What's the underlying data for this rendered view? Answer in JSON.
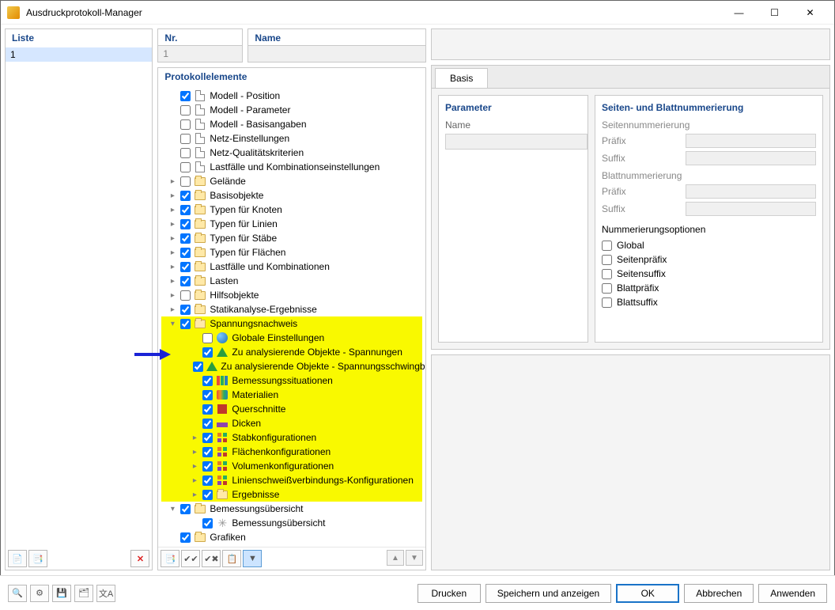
{
  "window": {
    "title": "Ausdruckprotokoll-Manager"
  },
  "liste": {
    "header": "Liste",
    "items": [
      "1"
    ]
  },
  "nr": {
    "header": "Nr.",
    "value": "1"
  },
  "name": {
    "header": "Name",
    "value": ""
  },
  "protokoll": {
    "header": "Protokollelemente",
    "items": [
      {
        "label": "Modell - Position",
        "checked": true,
        "icon": "doc",
        "indent": 1
      },
      {
        "label": "Modell - Parameter",
        "checked": false,
        "icon": "doc",
        "indent": 1
      },
      {
        "label": "Modell - Basisangaben",
        "checked": false,
        "icon": "doc",
        "indent": 1
      },
      {
        "label": "Netz-Einstellungen",
        "checked": false,
        "icon": "doc",
        "indent": 1
      },
      {
        "label": "Netz-Qualitätskriterien",
        "checked": false,
        "icon": "doc",
        "indent": 1
      },
      {
        "label": "Lastfälle und Kombinationseinstellungen",
        "checked": false,
        "icon": "doc",
        "indent": 1
      },
      {
        "label": "Gelände",
        "checked": false,
        "icon": "folder",
        "indent": 1,
        "caret": ">"
      },
      {
        "label": "Basisobjekte",
        "checked": true,
        "icon": "folder",
        "indent": 1,
        "caret": ">"
      },
      {
        "label": "Typen für Knoten",
        "checked": true,
        "icon": "folder",
        "indent": 1,
        "caret": ">"
      },
      {
        "label": "Typen für Linien",
        "checked": true,
        "icon": "folder",
        "indent": 1,
        "caret": ">"
      },
      {
        "label": "Typen für Stäbe",
        "checked": true,
        "icon": "folder",
        "indent": 1,
        "caret": ">"
      },
      {
        "label": "Typen für Flächen",
        "checked": true,
        "icon": "folder",
        "indent": 1,
        "caret": ">"
      },
      {
        "label": "Lastfälle und Kombinationen",
        "checked": true,
        "icon": "folder",
        "indent": 1,
        "caret": ">"
      },
      {
        "label": "Lasten",
        "checked": true,
        "icon": "folder",
        "indent": 1,
        "caret": ">"
      },
      {
        "label": "Hilfsobjekte",
        "checked": false,
        "icon": "folder",
        "indent": 1,
        "caret": ">"
      },
      {
        "label": "Statikanalyse-Ergebnisse",
        "checked": true,
        "icon": "folder",
        "indent": 1,
        "caret": ">"
      },
      {
        "label": "Spannungsnachweis",
        "checked": true,
        "icon": "folder",
        "indent": 1,
        "caret": "v",
        "hl": true
      },
      {
        "label": "Globale Einstellungen",
        "checked": false,
        "icon": "globe",
        "indent": 2,
        "hl": true
      },
      {
        "label": "Zu analysierende Objekte - Spannungen",
        "checked": true,
        "icon": "tri",
        "indent": 2,
        "hl": true
      },
      {
        "label": "Zu analysierende Objekte - Spannungsschwingbreiten",
        "checked": true,
        "icon": "tri",
        "indent": 2,
        "hl": true
      },
      {
        "label": "Bemessungssituationen",
        "checked": true,
        "icon": "bars",
        "indent": 2,
        "hl": true
      },
      {
        "label": "Materialien",
        "checked": true,
        "icon": "mat",
        "indent": 2,
        "hl": true
      },
      {
        "label": "Querschnitte",
        "checked": true,
        "icon": "sect",
        "indent": 2,
        "hl": true
      },
      {
        "label": "Dicken",
        "checked": true,
        "icon": "thick",
        "indent": 2,
        "hl": true
      },
      {
        "label": "Stabkonfigurationen",
        "checked": true,
        "icon": "cfg",
        "indent": 2,
        "caret": ">",
        "hl": true
      },
      {
        "label": "Flächenkonfigurationen",
        "checked": true,
        "icon": "cfg",
        "indent": 2,
        "caret": ">",
        "hl": true
      },
      {
        "label": "Volumenkonfigurationen",
        "checked": true,
        "icon": "cfg",
        "indent": 2,
        "caret": ">",
        "hl": true
      },
      {
        "label": "Linienschweißverbindungs-Konfigurationen",
        "checked": true,
        "icon": "cfg",
        "indent": 2,
        "caret": ">",
        "hl": true
      },
      {
        "label": "Ergebnisse",
        "checked": true,
        "icon": "folder",
        "indent": 2,
        "caret": ">",
        "hl": true
      },
      {
        "label": "Bemessungsübersicht",
        "checked": true,
        "icon": "folder",
        "indent": 1,
        "caret": "v"
      },
      {
        "label": "Bemessungsübersicht",
        "checked": true,
        "icon": "star",
        "indent": 2
      },
      {
        "label": "Grafiken",
        "checked": true,
        "icon": "folder",
        "indent": 1
      }
    ]
  },
  "basis": {
    "tab": "Basis",
    "parameter_heading": "Parameter",
    "name_label": "Name",
    "numbering_heading": "Seiten- und Blattnummerierung",
    "page_numbering": "Seitennummerierung",
    "sheet_numbering": "Blattnummerierung",
    "prefix": "Präfix",
    "suffix": "Suffix",
    "options_heading": "Nummerierungsoptionen",
    "options": [
      "Global",
      "Seitenpräfix",
      "Seitensuffix",
      "Blattpräfix",
      "Blattsuffix"
    ]
  },
  "buttons": {
    "print": "Drucken",
    "save_show": "Speichern und anzeigen",
    "ok": "OK",
    "cancel": "Abbrechen",
    "apply": "Anwenden"
  }
}
